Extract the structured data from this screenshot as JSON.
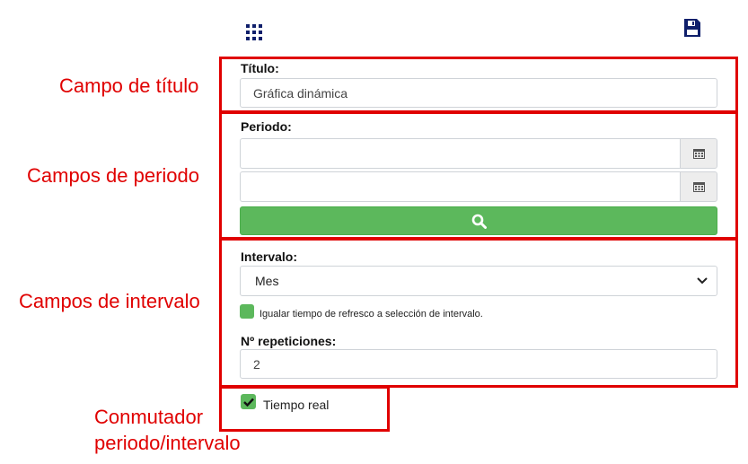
{
  "toolbar": {
    "apps_icon": "grid-icon",
    "save_icon": "floppy-disk-icon",
    "icon_color": "#0f1f6b"
  },
  "annotations": {
    "title": "Campo de título",
    "period": "Campos de periodo",
    "interval": "Campos de intervalo",
    "toggle_line1": "Conmutador",
    "toggle_line2": "periodo/intervalo",
    "color": "#e00000"
  },
  "form": {
    "title_label": "Título:",
    "title_value": "Gráfica dinámica",
    "period_label": "Periodo:",
    "period_start_value": "",
    "period_end_value": "",
    "calendar_icon": "calendar-icon",
    "search_icon": "search-icon",
    "search_color": "#5cb85c",
    "interval_label": "Intervalo:",
    "interval_selected": "Mes",
    "refresh_checkbox_label": "Igualar tiempo de refresco a selección de intervalo.",
    "repetitions_label": "Nº repeticiones:",
    "repetitions_value": "2",
    "realtime_label": "Tiempo real",
    "realtime_checked": true
  }
}
